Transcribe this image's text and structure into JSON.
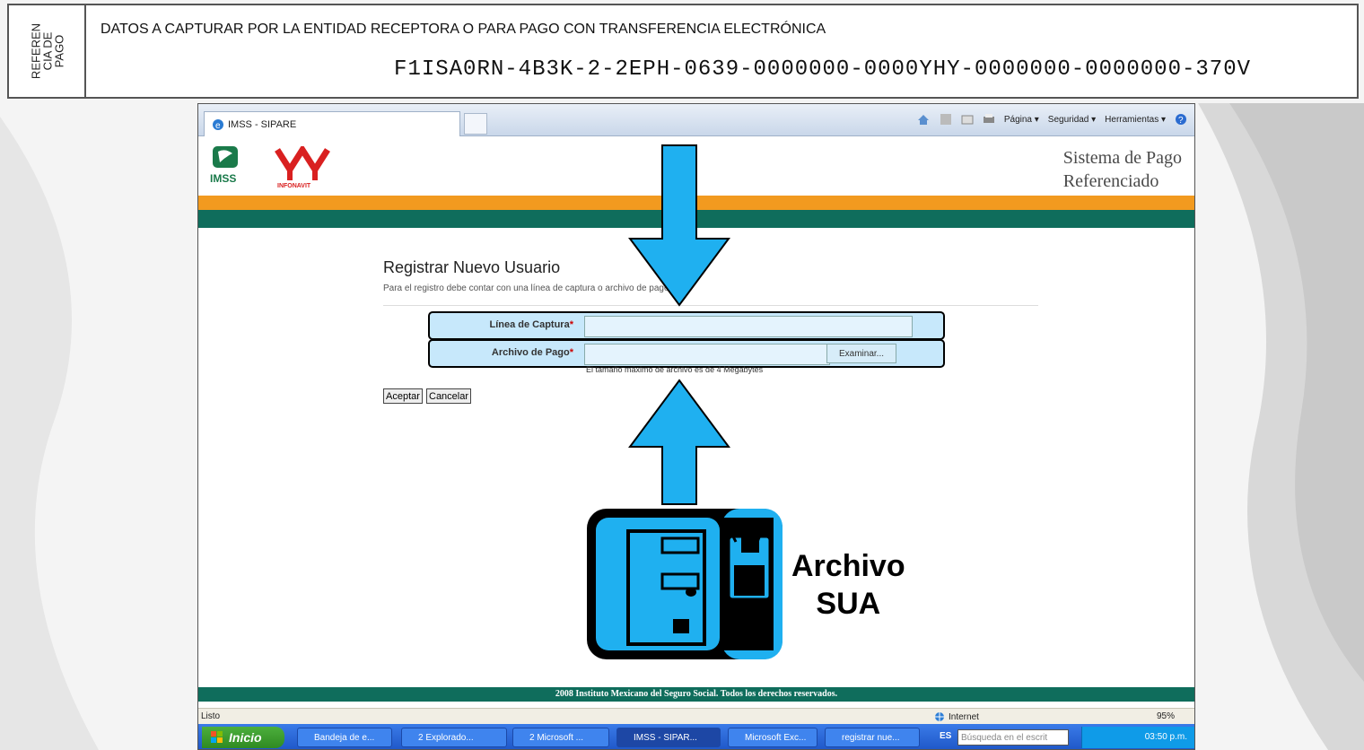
{
  "reference": {
    "side_label": "REFEREN\nCIA DE\nPAGO",
    "caption": "DATOS A CAPTURAR POR LA ENTIDAD RECEPTORA O PARA PAGO CON TRANSFERENCIA ELECTRÓNICA",
    "code": "F1ISA0RN-4B3K-2-2EPH-0639-0000000-0000YHY-0000000-0000000-370V"
  },
  "browser": {
    "tab_title": "IMSS - SIPARE",
    "command_bar": [
      "Página ▾",
      "Seguridad ▾",
      "Herramientas ▾"
    ]
  },
  "site": {
    "imss_logo": "IMSS",
    "infonavit_logo": "INFONAVIT",
    "title_line1": "Sistema de Pago",
    "title_line2": "Referenciado",
    "footer": "2008 Instituto Mexicano del Seguro Social. Todos los derechos reservados."
  },
  "form": {
    "title": "Registrar Nuevo Usuario",
    "subtitle": "Para el registro debe contar con una línea de captura o archivo de pago SUA",
    "linea_label": "Línea de Captura",
    "archivo_label": "Archivo de Pago",
    "required_mark": "*",
    "linea_value": "",
    "archivo_value": "",
    "browse_label": "Examinar...",
    "size_hint": "El tamaño máximo de archivo es de 4 Megabytes",
    "accept_label": "Aceptar",
    "cancel_label": "Cancelar"
  },
  "status_bar": {
    "status": "Listo",
    "zone": "Internet",
    "zoom": "95%"
  },
  "taskbar": {
    "start_label": "Inicio",
    "tasks": [
      "Bandeja de e...",
      "2 Explorado...",
      "2 Microsoft ...",
      "IMSS - SIPAR...",
      "Microsoft Exc...",
      "registrar nue..."
    ],
    "lang": "ES",
    "search_placeholder": "Búsqueda en el escrit",
    "clock": "03:50 p.m."
  },
  "annotation": {
    "label_line1": "Archivo",
    "label_line2": "SUA"
  },
  "colors": {
    "arrow": "#1fb0f0",
    "orange_band": "#f29a1f",
    "green_band": "#0f6d5c",
    "field_bg": "#c7e8fb"
  }
}
